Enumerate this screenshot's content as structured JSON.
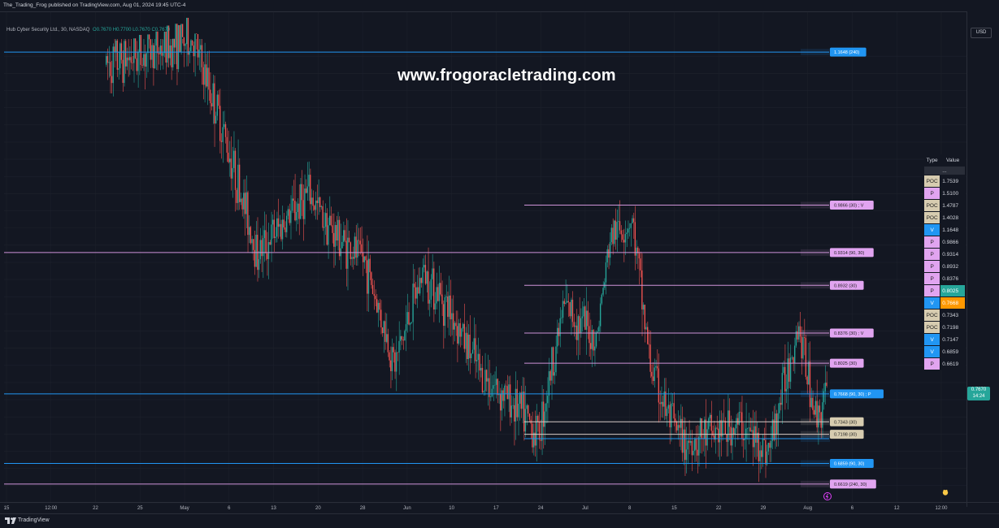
{
  "header": {
    "publisher": "The_Trading_Frog published on TradingView.com, Aug 01, 2024 19:45 UTC-4"
  },
  "symbol": {
    "name": "Hub Cyber Security Ltd., 30, NASDAQ",
    "ohlc": "O0.7670 H0.7700 L0.7670 C0.7670"
  },
  "watermark": "www.frogoracletrading.com",
  "currency": "USD",
  "last_price": {
    "value": "0.7670",
    "countdown": "14:24"
  },
  "footer": {
    "brand": "TradingView"
  },
  "colors": {
    "background": "#131722",
    "grid": "#1e222d",
    "up": "#26a69a",
    "down": "#ef5350",
    "line_blue": "#2196f3",
    "line_purple": "#ce93d8",
    "line_tan": "#d7ccc8",
    "label_blue": "#2196f3",
    "label_purple": "#e1a4f0",
    "label_tan": "#d7ccb0",
    "highlight_green": "#26a69a",
    "highlight_orange": "#ff9800"
  },
  "table": {
    "headers": [
      "Type",
      "Value"
    ],
    "separator": "...",
    "rows": [
      {
        "type": "POC",
        "value": "1.7539",
        "kind": "poc"
      },
      {
        "type": "P",
        "value": "1.5100",
        "kind": "p"
      },
      {
        "type": "POC",
        "value": "1.4787",
        "kind": "poc"
      },
      {
        "type": "POC",
        "value": "1.4028",
        "kind": "poc"
      },
      {
        "type": "V",
        "value": "1.1648",
        "kind": "v"
      },
      {
        "type": "P",
        "value": "0.9866",
        "kind": "p"
      },
      {
        "type": "P",
        "value": "0.9314",
        "kind": "p"
      },
      {
        "type": "P",
        "value": "0.8932",
        "kind": "p"
      },
      {
        "type": "P",
        "value": "0.8376",
        "kind": "p"
      },
      {
        "type": "P",
        "value": "0.8025",
        "kind": "p",
        "highlight": "green"
      },
      {
        "type": "V",
        "value": "0.7668",
        "kind": "v",
        "highlight": "orange"
      },
      {
        "type": "POC",
        "value": "0.7343",
        "kind": "poc"
      },
      {
        "type": "POC",
        "value": "0.7198",
        "kind": "poc"
      },
      {
        "type": "V",
        "value": "0.7147",
        "kind": "v"
      },
      {
        "type": "V",
        "value": "0.6859",
        "kind": "v"
      },
      {
        "type": "P",
        "value": "0.6619",
        "kind": "p"
      }
    ]
  },
  "chart_data": {
    "type": "candlestick",
    "ylim": [
      0.64,
      1.18
    ],
    "y_ticks": [
      "1.16",
      "1.14",
      "1.12",
      "1.10",
      "1.08",
      "1.06",
      "1.04",
      "1.02",
      "1.0000",
      "0.9800",
      "0.9600",
      "0.9400",
      "0.9200",
      "0.9000",
      "0.8800",
      "0.8600",
      "0.8400",
      "0.8200",
      "0.8000",
      "0.7800",
      "0.7600",
      "0.7400",
      "0.7200",
      "0.7000",
      "0.6800",
      "0.6600",
      "0.6400"
    ],
    "x_ticks": [
      "15",
      "12:00",
      "22",
      "25",
      "May",
      "6",
      "13",
      "20",
      "28",
      "Jun",
      "10",
      "17",
      "24",
      "Jul",
      "8",
      "15",
      "22",
      "29",
      "Aug",
      "6",
      "12",
      "12:00"
    ],
    "levels": [
      {
        "price": 1.1648,
        "label": "1.1648 (240)",
        "color": "blue",
        "start": "Apr 15"
      },
      {
        "price": 0.9866,
        "label": "0.9866 (30) ; V",
        "color": "purple",
        "start": "Jun 19"
      },
      {
        "price": 0.9314,
        "label": "0.9314 (90, 30)",
        "color": "purple",
        "start": "Apr 15"
      },
      {
        "price": 0.8932,
        "label": "0.8932 (30)",
        "color": "purple",
        "start": "Jun 19"
      },
      {
        "price": 0.8376,
        "label": "0.8376 (30) ; V",
        "color": "purple",
        "start": "Jun 19"
      },
      {
        "price": 0.8025,
        "label": "0.8025 (30)",
        "color": "purple",
        "start": "Jun 19"
      },
      {
        "price": 0.7668,
        "label": "0.7668 (90, 30) ; P",
        "color": "blue",
        "start": "Apr 15"
      },
      {
        "price": 0.7343,
        "label": "0.7343 (30)",
        "color": "tan",
        "start": "Jun 19"
      },
      {
        "price": 0.7198,
        "label": "0.7198 (30)",
        "color": "tan",
        "start": "Jun 19"
      },
      {
        "price": 0.7147,
        "label": "",
        "color": "blue",
        "start": "Jun 19"
      },
      {
        "price": 0.6859,
        "label": "0.6859 (90, 30)",
        "color": "blue",
        "start": "Apr 15"
      },
      {
        "price": 0.6619,
        "label": "0.6619 (240, 30)",
        "color": "purple",
        "start": "Apr 15"
      }
    ],
    "price_path": [
      [
        0,
        1.15
      ],
      [
        0.12,
        1.18
      ],
      [
        0.16,
        1.08
      ],
      [
        0.21,
        0.93
      ],
      [
        0.28,
        1.0
      ],
      [
        0.32,
        0.95
      ],
      [
        0.36,
        0.92
      ],
      [
        0.4,
        0.8
      ],
      [
        0.44,
        0.91
      ],
      [
        0.48,
        0.86
      ],
      [
        0.52,
        0.79
      ],
      [
        0.56,
        0.76
      ],
      [
        0.6,
        0.72
      ],
      [
        0.635,
        0.87
      ],
      [
        0.68,
        0.83
      ],
      [
        0.7,
        0.95
      ],
      [
        0.73,
        0.97
      ],
      [
        0.755,
        0.8
      ],
      [
        0.78,
        0.74
      ],
      [
        0.8,
        0.71
      ],
      [
        0.84,
        0.72
      ],
      [
        0.88,
        0.73
      ],
      [
        0.92,
        0.7
      ],
      [
        0.96,
        0.85
      ],
      [
        0.985,
        0.74
      ],
      [
        1.0,
        0.767
      ]
    ]
  }
}
